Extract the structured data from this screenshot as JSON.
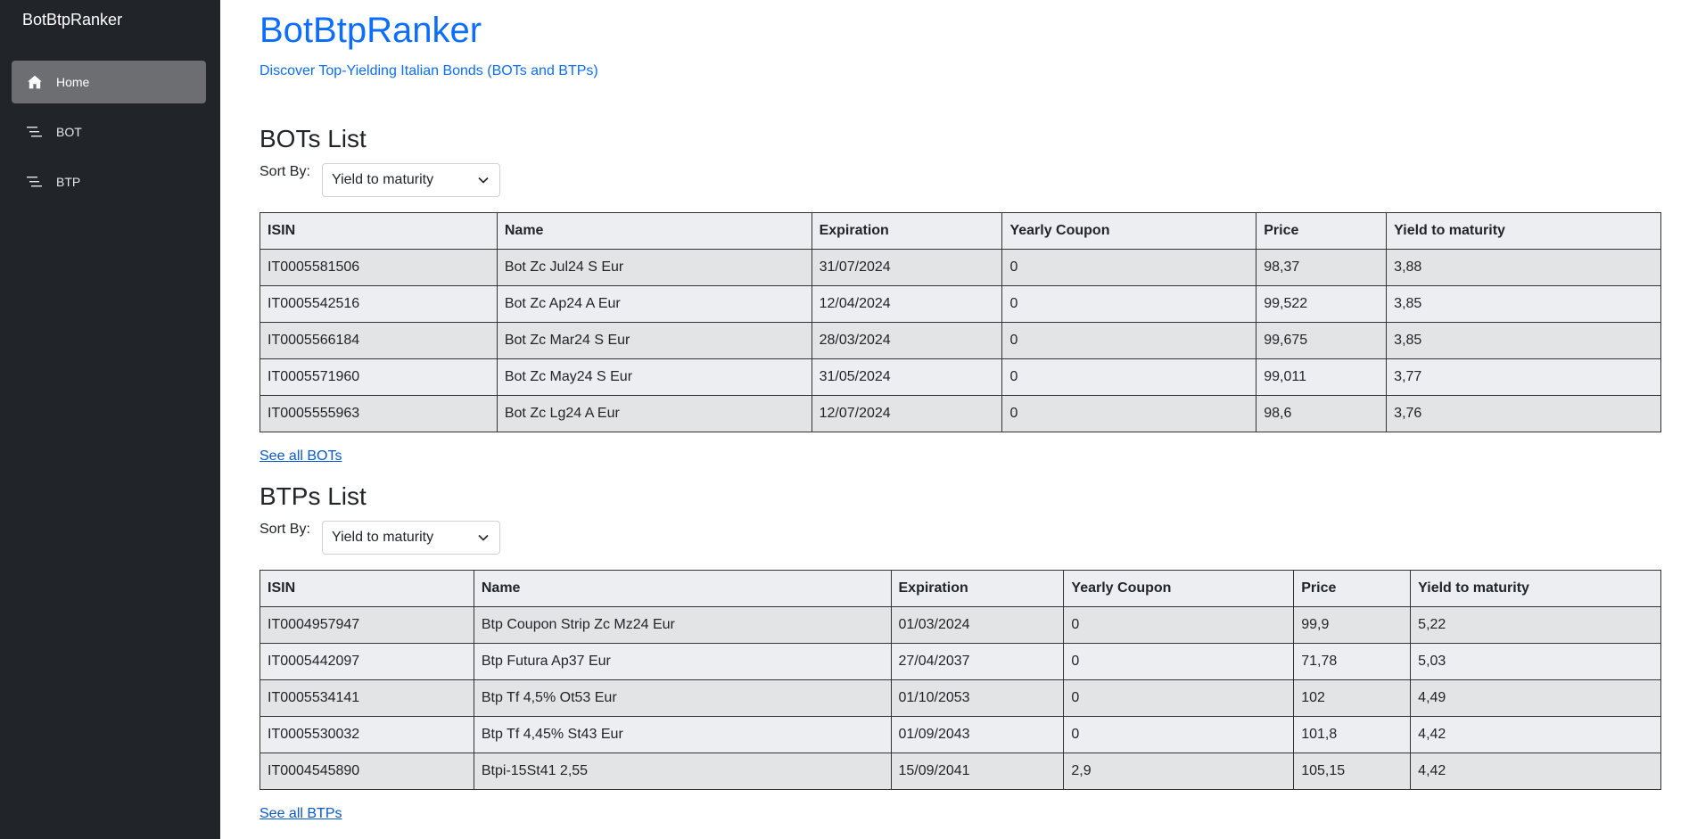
{
  "sidebar": {
    "brand": "BotBtpRanker",
    "items": [
      {
        "label": "Home",
        "icon": "home-icon",
        "active": true
      },
      {
        "label": "BOT",
        "icon": "list-icon",
        "active": false
      },
      {
        "label": "BTP",
        "icon": "list-icon",
        "active": false
      }
    ]
  },
  "header": {
    "title": "BotBtpRanker",
    "subtitle": "Discover Top-Yielding Italian Bonds (BOTs and BTPs)"
  },
  "bots": {
    "title": "BOTs List",
    "sort_label": "Sort By:",
    "sort_value": "Yield to maturity",
    "columns": [
      "ISIN",
      "Name",
      "Expiration",
      "Yearly Coupon",
      "Price",
      "Yield to maturity"
    ],
    "rows": [
      [
        "IT0005581506",
        "Bot Zc Jul24 S Eur",
        "31/07/2024",
        "0",
        "98,37",
        "3,88"
      ],
      [
        "IT0005542516",
        "Bot Zc Ap24 A Eur",
        "12/04/2024",
        "0",
        "99,522",
        "3,85"
      ],
      [
        "IT0005566184",
        "Bot Zc Mar24 S Eur",
        "28/03/2024",
        "0",
        "99,675",
        "3,85"
      ],
      [
        "IT0005571960",
        "Bot Zc May24 S Eur",
        "31/05/2024",
        "0",
        "99,011",
        "3,77"
      ],
      [
        "IT0005555963",
        "Bot Zc Lg24 A Eur",
        "12/07/2024",
        "0",
        "98,6",
        "3,76"
      ]
    ],
    "see_all": "See all BOTs"
  },
  "btps": {
    "title": "BTPs List",
    "sort_label": "Sort By:",
    "sort_value": "Yield to maturity",
    "columns": [
      "ISIN",
      "Name",
      "Expiration",
      "Yearly Coupon",
      "Price",
      "Yield to maturity"
    ],
    "rows": [
      [
        "IT0004957947",
        "Btp Coupon Strip Zc Mz24 Eur",
        "01/03/2024",
        "0",
        "99,9",
        "5,22"
      ],
      [
        "IT0005442097",
        "Btp Futura Ap37 Eur",
        "27/04/2037",
        "0",
        "71,78",
        "5,03"
      ],
      [
        "IT0005534141",
        "Btp Tf 4,5% Ot53 Eur",
        "01/10/2053",
        "0",
        "102",
        "4,49"
      ],
      [
        "IT0005530032",
        "Btp Tf 4,45% St43 Eur",
        "01/09/2043",
        "0",
        "101,8",
        "4,42"
      ],
      [
        "IT0004545890",
        "Btpi-15St41 2,55",
        "15/09/2041",
        "2,9",
        "105,15",
        "4,42"
      ]
    ],
    "see_all": "See all BTPs"
  },
  "colors": {
    "sidebar_bg": "#212529",
    "accent": "#0d6efd",
    "active_nav": "#6c6e71"
  }
}
